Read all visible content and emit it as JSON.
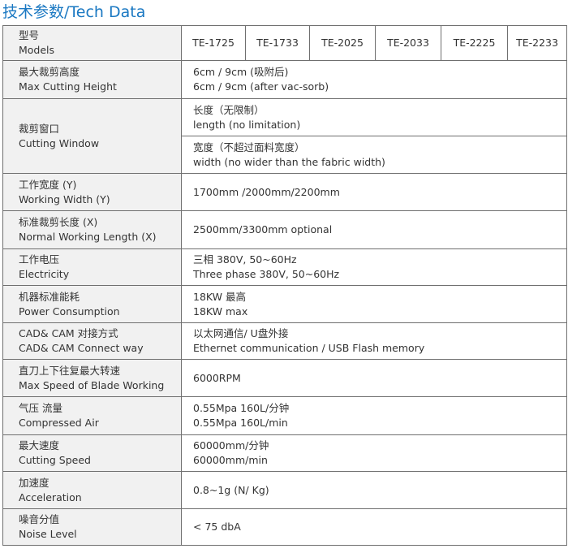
{
  "title": {
    "cn": "技术参数",
    "slash": "/",
    "en": "Tech Data"
  },
  "header": {
    "label_cn": "型号",
    "label_en": "Models",
    "models": [
      "TE-1725",
      "TE-1733",
      "TE-2025",
      "TE-2033",
      "TE-2225",
      "TE-2233"
    ]
  },
  "rows": [
    {
      "label_cn": "最大裁剪高度",
      "label_en": "Max Cutting Height",
      "value_cn": "6cm / 9cm (吸附后)",
      "value_en": "6cm / 9cm (after vac-sorb)"
    },
    {
      "label_cn": "裁剪窗口",
      "label_en": "Cutting Window",
      "value_cn": "长度（无限制）",
      "value_en": "length (no limitation)",
      "value2_cn": "宽度（不超过面料宽度）",
      "value2_en": "width (no wider than the fabric width)"
    },
    {
      "label_cn": "工作宽度 (Y)",
      "label_en": "Working Width (Y)",
      "value": "1700mm /2000mm/2200mm"
    },
    {
      "label_cn": "标准裁剪长度 (X)",
      "label_en": "Normal Working Length (X)",
      "value": "2500mm/3300mm optional"
    },
    {
      "label_cn": "工作电压",
      "label_en": "Electricity",
      "value_cn": "三相 380V, 50~60Hz",
      "value_en": "Three phase 380V, 50~60Hz"
    },
    {
      "label_cn": "机器标准能耗",
      "label_en": "Power Consumption",
      "value_cn": "18KW 最高",
      "value_en": "18KW max"
    },
    {
      "label_cn": "CAD& CAM 对接方式",
      "label_en": "CAD& CAM Connect way",
      "value_cn": "以太网通信/ U盘外接",
      "value_en": "Ethernet communication / USB Flash memory"
    },
    {
      "label_cn": "直刀上下往复最大转速",
      "label_en": "Max Speed of Blade Working",
      "value": "6000RPM"
    },
    {
      "label_cn": "气压 流量",
      "label_en": "Compressed Air",
      "value_cn": "0.55Mpa 160L/分钟",
      "value_en": "0.55Mpa 160L/min"
    },
    {
      "label_cn": "最大速度",
      "label_en": "Cutting Speed",
      "value_cn": "60000mm/分钟",
      "value_en": "60000mm/min"
    },
    {
      "label_cn": "加速度",
      "label_en": "Acceleration",
      "value": "0.8~1g (N/ Kg)"
    },
    {
      "label_cn": "噪音分值",
      "label_en": "Noise Level",
      "value": "< 75 dbA"
    }
  ]
}
